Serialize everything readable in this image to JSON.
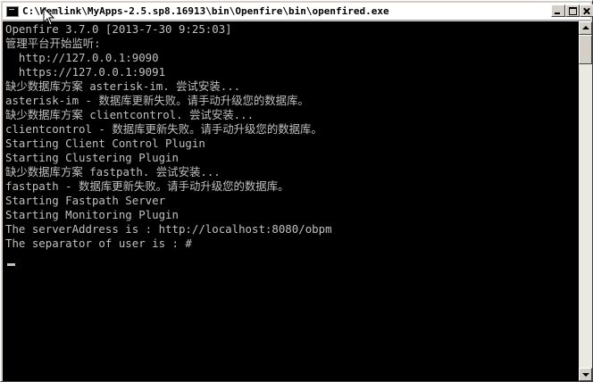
{
  "window": {
    "title": "C:\\Wemlink\\MyApps-2.5.sp8.16913\\bin\\Openfire\\bin\\openfired.exe",
    "minimize_icon": "minimize-icon",
    "maximize_icon": "maximize-icon",
    "close_icon": "close-icon"
  },
  "console": {
    "lines": [
      "Openfire 3.7.0 [2013-7-30 9:25:03]",
      "管理平台开始监听:",
      "  http://127.0.0.1:9090",
      "  https://127.0.0.1:9091",
      "缺少数据库方案 asterisk-im. 尝试安装...",
      "asterisk-im - 数据库更新失败。请手动升级您的数据库。",
      "缺少数据库方案 clientcontrol. 尝试安装...",
      "clientcontrol - 数据库更新失败。请手动升级您的数据库。",
      "Starting Client Control Plugin",
      "Starting Clustering Plugin",
      "缺少数据库方案 fastpath. 尝试安装...",
      "fastpath - 数据库更新失败。请手动升级您的数据库。",
      "Starting Fastpath Server",
      "Starting Monitoring Plugin",
      "The serverAddress is : http://localhost:8080/obpm",
      "The separator of user is : #"
    ]
  },
  "colors": {
    "console_bg": "#000000",
    "console_text": "#c0c0c0",
    "chrome": "#d4d0c8"
  }
}
